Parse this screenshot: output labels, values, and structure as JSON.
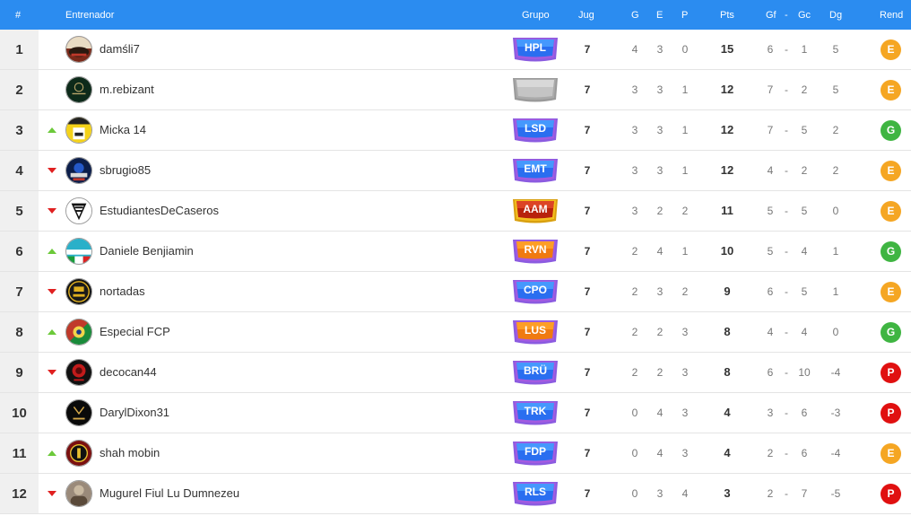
{
  "header": {
    "rank": "#",
    "coach": "Entrenador",
    "group": "Grupo",
    "played": "Jug",
    "won": "G",
    "drawn": "E",
    "lost": "P",
    "points": "Pts",
    "gf": "Gf",
    "sep": "-",
    "gc": "Gc",
    "dg": "Dg",
    "rend": "Rend"
  },
  "colors": {
    "header_bg": "#2b8cf0",
    "rend_E": "#f5a623",
    "rend_G": "#3fb542",
    "rend_P": "#e01010",
    "trend_up": "#6cc93a",
    "trend_down": "#e02020"
  },
  "rows": [
    {
      "rank": "1",
      "trend": "none",
      "name": "damśli7",
      "group": "HPL",
      "badge": "blue",
      "jug": "7",
      "g": "4",
      "e": "3",
      "p": "0",
      "pts": "15",
      "gf": "6",
      "gc": "1",
      "dg": "5",
      "rend": "E",
      "avatar": "avatar-1"
    },
    {
      "rank": "2",
      "trend": "none",
      "name": "m.rebizant",
      "group": "",
      "badge": "gray",
      "jug": "7",
      "g": "3",
      "e": "3",
      "p": "1",
      "pts": "12",
      "gf": "7",
      "gc": "2",
      "dg": "5",
      "rend": "E",
      "avatar": "avatar-2"
    },
    {
      "rank": "3",
      "trend": "up",
      "name": "Micka 14",
      "group": "LSD",
      "badge": "blue",
      "jug": "7",
      "g": "3",
      "e": "3",
      "p": "1",
      "pts": "12",
      "gf": "7",
      "gc": "5",
      "dg": "2",
      "rend": "G",
      "avatar": "avatar-3"
    },
    {
      "rank": "4",
      "trend": "down",
      "name": "sbrugio85",
      "group": "EMT",
      "badge": "blue",
      "jug": "7",
      "g": "3",
      "e": "3",
      "p": "1",
      "pts": "12",
      "gf": "4",
      "gc": "2",
      "dg": "2",
      "rend": "E",
      "avatar": "avatar-4"
    },
    {
      "rank": "5",
      "trend": "down",
      "name": "EstudiantesDeCaseros",
      "group": "AAM",
      "badge": "red",
      "jug": "7",
      "g": "3",
      "e": "2",
      "p": "2",
      "pts": "11",
      "gf": "5",
      "gc": "5",
      "dg": "0",
      "rend": "E",
      "avatar": "avatar-5"
    },
    {
      "rank": "6",
      "trend": "up",
      "name": "Daniele Benjiamin",
      "group": "RVN",
      "badge": "orange",
      "jug": "7",
      "g": "2",
      "e": "4",
      "p": "1",
      "pts": "10",
      "gf": "5",
      "gc": "4",
      "dg": "1",
      "rend": "G",
      "avatar": "avatar-6"
    },
    {
      "rank": "7",
      "trend": "down",
      "name": "nortadas",
      "group": "CPO",
      "badge": "blue",
      "jug": "7",
      "g": "2",
      "e": "3",
      "p": "2",
      "pts": "9",
      "gf": "6",
      "gc": "5",
      "dg": "1",
      "rend": "E",
      "avatar": "avatar-7"
    },
    {
      "rank": "8",
      "trend": "up",
      "name": "Especial FCP",
      "group": "LUS",
      "badge": "orange",
      "jug": "7",
      "g": "2",
      "e": "2",
      "p": "3",
      "pts": "8",
      "gf": "4",
      "gc": "4",
      "dg": "0",
      "rend": "G",
      "avatar": "avatar-8"
    },
    {
      "rank": "9",
      "trend": "down",
      "name": "decocan44",
      "group": "BRÜ",
      "badge": "blue",
      "jug": "7",
      "g": "2",
      "e": "2",
      "p": "3",
      "pts": "8",
      "gf": "6",
      "gc": "10",
      "dg": "-4",
      "rend": "P",
      "avatar": "avatar-9"
    },
    {
      "rank": "10",
      "trend": "none",
      "name": "DarylDixon31",
      "group": "TRK",
      "badge": "blue",
      "jug": "7",
      "g": "0",
      "e": "4",
      "p": "3",
      "pts": "4",
      "gf": "3",
      "gc": "6",
      "dg": "-3",
      "rend": "P",
      "avatar": "avatar-10"
    },
    {
      "rank": "11",
      "trend": "up",
      "name": "shah mobin",
      "group": "FDP",
      "badge": "blue",
      "jug": "7",
      "g": "0",
      "e": "4",
      "p": "3",
      "pts": "4",
      "gf": "2",
      "gc": "6",
      "dg": "-4",
      "rend": "E",
      "avatar": "avatar-11"
    },
    {
      "rank": "12",
      "trend": "down",
      "name": "Mugurel Fiul Lu Dumnezeu",
      "group": "RLS",
      "badge": "blue",
      "jug": "7",
      "g": "0",
      "e": "3",
      "p": "4",
      "pts": "3",
      "gf": "2",
      "gc": "7",
      "dg": "-5",
      "rend": "P",
      "avatar": "avatar-12"
    }
  ]
}
